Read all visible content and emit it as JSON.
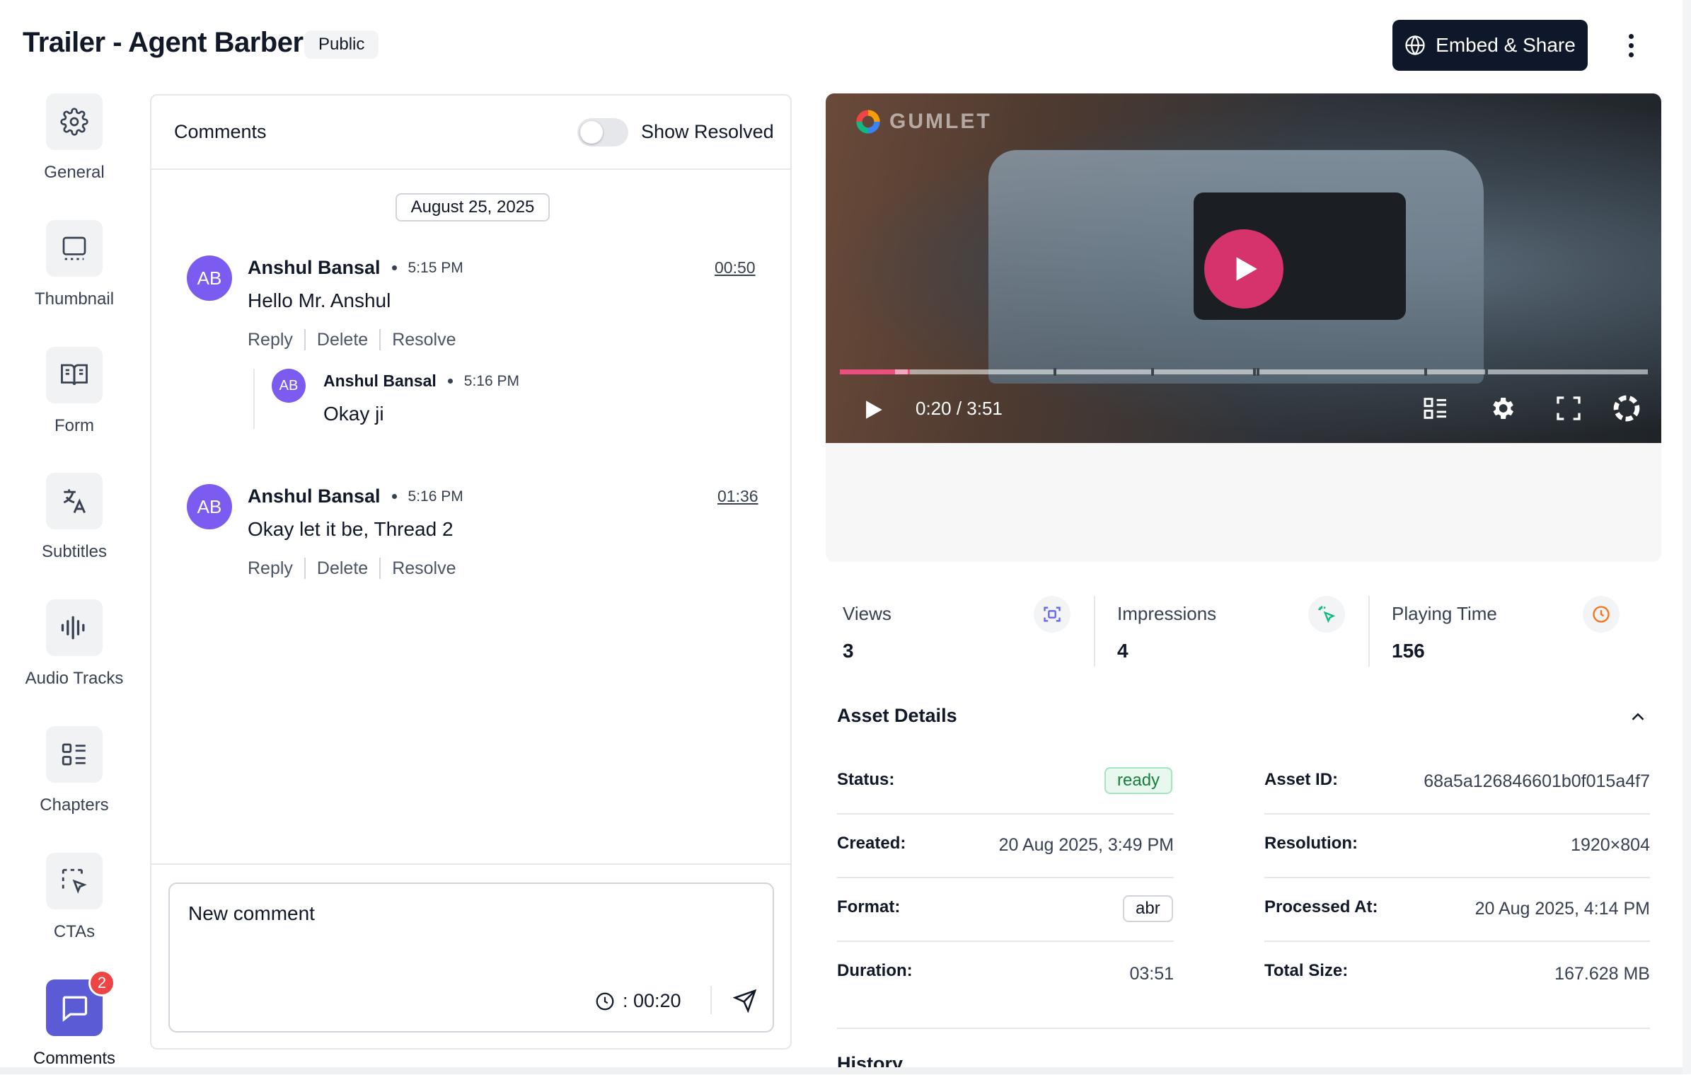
{
  "header": {
    "title": "Trailer - Agent Barber",
    "visibility": "Public",
    "embed_label": "Embed & Share"
  },
  "sidebar": {
    "items": [
      {
        "label": "General",
        "icon": "gear-icon"
      },
      {
        "label": "Thumbnail",
        "icon": "monitor-icon"
      },
      {
        "label": "Form",
        "icon": "book-open-icon"
      },
      {
        "label": "Subtitles",
        "icon": "translate-icon"
      },
      {
        "label": "Audio Tracks",
        "icon": "audio-wave-icon"
      },
      {
        "label": "Chapters",
        "icon": "list-layout-icon"
      },
      {
        "label": "CTAs",
        "icon": "cursor-select-icon"
      },
      {
        "label": "Comments",
        "icon": "chat-icon",
        "badge": "2",
        "active": true
      }
    ]
  },
  "comments": {
    "title": "Comments",
    "show_resolved_label": "Show Resolved",
    "date": "August 25, 2025",
    "threads": [
      {
        "initials": "AB",
        "author": "Anshul Bansal",
        "time": "5:15 PM",
        "timestamp": "00:50",
        "text": "Hello Mr. Anshul",
        "actions": [
          "Reply",
          "Delete",
          "Resolve"
        ],
        "reply": {
          "initials": "AB",
          "author": "Anshul Bansal",
          "time": "5:16 PM",
          "text": "Okay ji"
        }
      },
      {
        "initials": "AB",
        "author": "Anshul Bansal",
        "time": "5:16 PM",
        "timestamp": "01:36",
        "text": "Okay let it be, Thread 2",
        "actions": [
          "Reply",
          "Delete",
          "Resolve"
        ]
      }
    ],
    "compose": {
      "placeholder": "New comment",
      "time": ": 00:20"
    }
  },
  "player": {
    "watermark": "GUMLET",
    "time": "0:20 / 3:51",
    "progress_fraction": 0.087
  },
  "stats": [
    {
      "label": "Views",
      "value": "3",
      "icon": "scan-icon",
      "color": "#6366f1"
    },
    {
      "label": "Impressions",
      "value": "4",
      "icon": "sparkle-cursor-icon",
      "color": "#10b981"
    },
    {
      "label": "Playing Time",
      "value": "156",
      "icon": "clock-icon",
      "color": "#f97316"
    }
  ],
  "asset_details": {
    "title": "Asset Details",
    "left": [
      {
        "label": "Status:",
        "value": "ready",
        "kind": "pill-ready"
      },
      {
        "label": "Created:",
        "value": "20 Aug 2025, 3:49 PM"
      },
      {
        "label": "Format:",
        "value": "abr",
        "kind": "pill"
      },
      {
        "label": "Duration:",
        "value": "03:51"
      }
    ],
    "right": [
      {
        "label": "Asset ID:",
        "value": "68a5a126846601b0f015a4f7"
      },
      {
        "label": "Resolution:",
        "value": "1920×804"
      },
      {
        "label": "Processed At:",
        "value": "20 Aug 2025, 4:14 PM"
      },
      {
        "label": "Total Size:",
        "value": "167.628 MB"
      }
    ]
  },
  "history": {
    "title": "History"
  },
  "colors": {
    "accent": "#5b5bd6",
    "avatar": "#7c5cf0",
    "play": "#d6336c",
    "dark_button": "#0f172a"
  }
}
